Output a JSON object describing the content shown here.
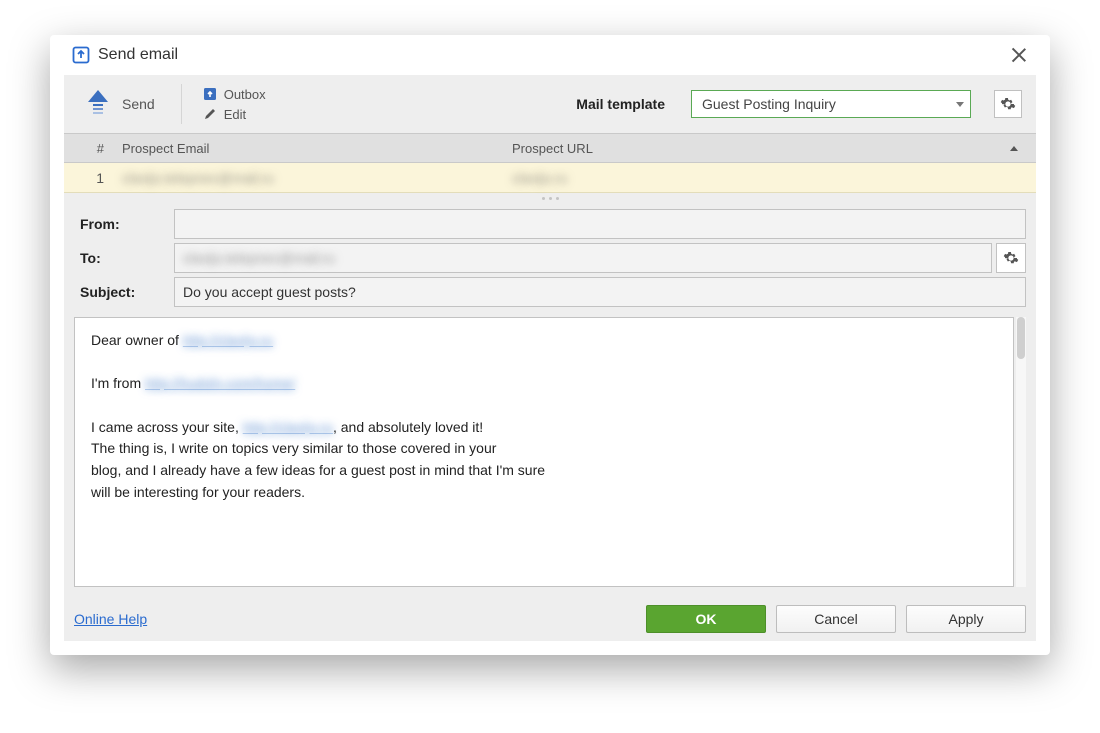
{
  "title": "Send email",
  "toolbar": {
    "send": "Send",
    "outbox": "Outbox",
    "edit": "Edit",
    "mail_template_label": "Mail template",
    "template_selected": "Guest Posting Inquiry"
  },
  "columns": {
    "num": "#",
    "email": "Prospect Email",
    "url": "Prospect URL"
  },
  "rows": [
    {
      "num": "1",
      "email": "clavijo.telepnev@mail.ru",
      "url": "clavijo.ru"
    }
  ],
  "form": {
    "from_label": "From:",
    "from_value": "",
    "to_label": "To:",
    "to_value": "clavijo.telepnev@mail.ru",
    "subject_label": "Subject:",
    "subject_value": "Do you accept guest posts?"
  },
  "body": {
    "line1_pre": "Dear owner of ",
    "line1_link": "http://clavijo.ru",
    "line2_pre": "I'm  from ",
    "line2_link": "http://hudoln.com/home/",
    "line3_pre": "I came across your site, ",
    "line3_link": "http://clavijo.ru",
    "line3_post": ", and absolutely loved it!",
    "line4": "The thing is, I write on topics very similar to those covered in your",
    "line5": "blog, and I already have a few ideas for a guest post in mind that I'm sure",
    "line6": "will be interesting for your readers."
  },
  "footer": {
    "help": "Online Help",
    "ok": "OK",
    "cancel": "Cancel",
    "apply": "Apply"
  }
}
